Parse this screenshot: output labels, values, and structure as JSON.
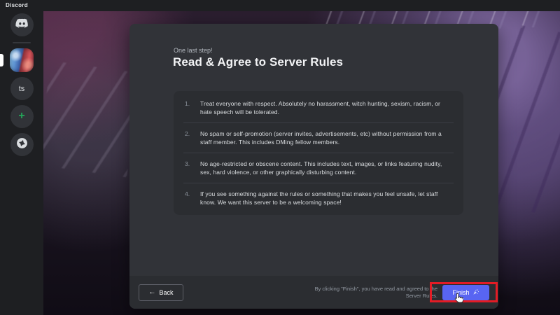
{
  "app": {
    "title": "Discord"
  },
  "sidebar": {
    "home": {
      "icon": "discord-logo-icon"
    },
    "servers": [
      {
        "id": "current-server",
        "type": "image",
        "icon": "server-art-icon",
        "selected": true
      },
      {
        "id": "server-ts",
        "label": "ts"
      }
    ],
    "add_server": {
      "icon": "plus-icon",
      "color": "#23a559"
    },
    "explore": {
      "icon": "compass-icon"
    }
  },
  "modal": {
    "eyebrow": "One last step!",
    "title": "Read & Agree to Server Rules",
    "rules": [
      {
        "num": "1.",
        "text": "Treat everyone with respect. Absolutely no harassment, witch hunting, sexism, racism, or hate speech will be tolerated."
      },
      {
        "num": "2.",
        "text": "No spam or self-promotion (server invites, advertisements, etc) without permission from a staff member. This includes DMing fellow members."
      },
      {
        "num": "3.",
        "text": "No age-restricted or obscene content. This includes text, images, or links featuring nudity, sex, hard violence, or other graphically disturbing content."
      },
      {
        "num": "4.",
        "text": "If you see something against the rules or something that makes you feel unsafe, let staff know. We want this server to be a welcoming space!"
      }
    ],
    "footer": {
      "back_arrow": "←",
      "back_label": "Back",
      "note": "By clicking \"Finish\", you have read and agreed to the Server Rules.",
      "finish_label": "Finish",
      "finish_icon": "party-popper-icon"
    }
  },
  "annotation": {
    "shape": "red-rectangle",
    "color": "#e31c25",
    "target": "finish-button"
  },
  "colors": {
    "sidebar_bg": "#1e1f22",
    "modal_bg": "#313338",
    "panel_bg": "#2b2d31",
    "accent_blurple": "#5865f2",
    "add_green": "#23a559",
    "text_primary": "#f2f3f5",
    "text_secondary": "#b5bac1",
    "text_muted": "#949ba4"
  }
}
